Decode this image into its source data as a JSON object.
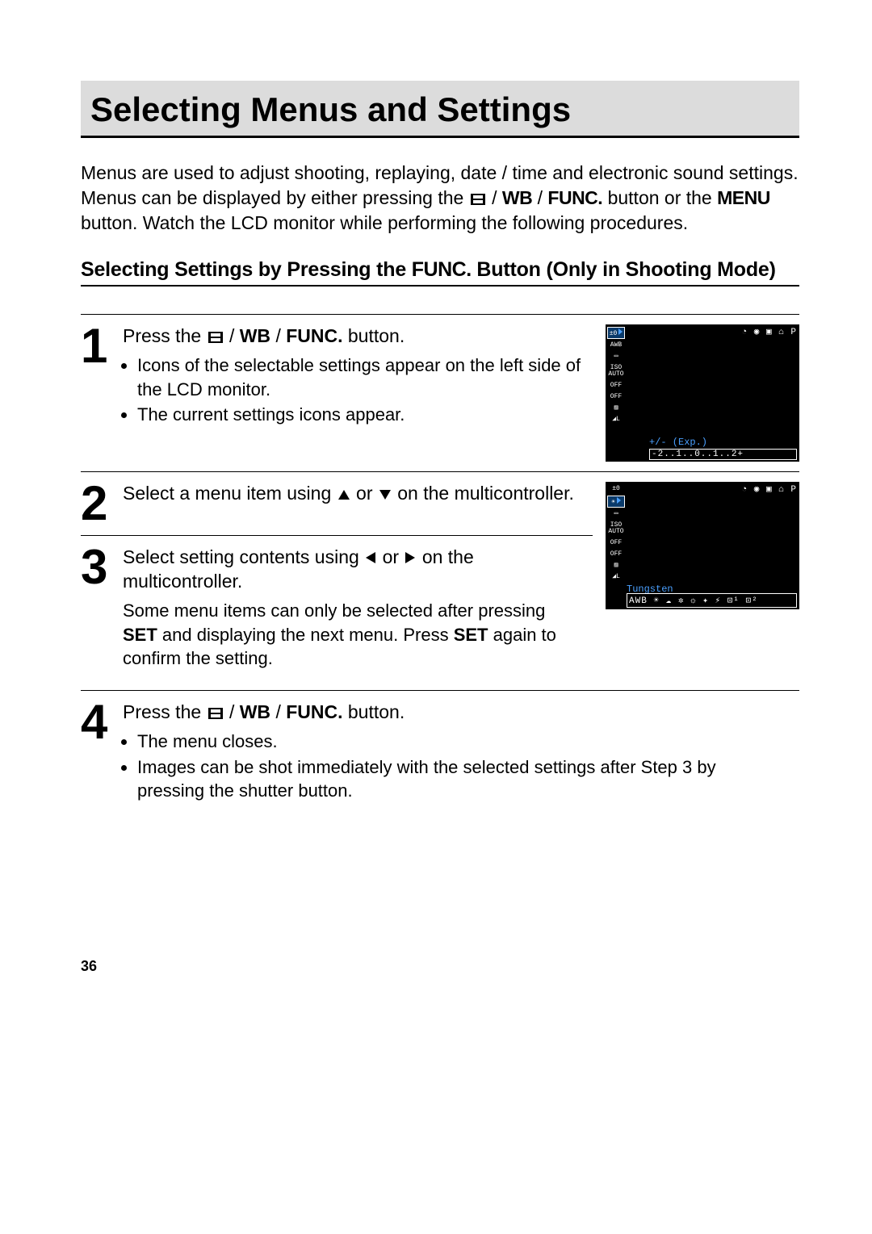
{
  "page": {
    "title": "Selecting Menus and Settings",
    "page_number": "36"
  },
  "intro": {
    "text_pre": "Menus are used to adjust shooting, replaying, date / time and electronic sound settings. Menus can be displayed by either pressing the ",
    "wb": "WB",
    "slash": " / ",
    "func": "FUNC.",
    "text_mid": " button or the ",
    "menu": "MENU",
    "text_post": " button. Watch the LCD monitor while performing the following procedures."
  },
  "subhead": {
    "pre": "Selecting Settings by Pressing the ",
    "func": "FUNC.",
    "post": " Button (Only in Shooting Mode)"
  },
  "steps": {
    "s1": {
      "num": "1",
      "head_pre": "Press the ",
      "wb": "WB",
      "slash": " / ",
      "func": "FUNC.",
      "head_post": " button.",
      "bullet1": "Icons of the selectable settings appear on the left side of the LCD monitor.",
      "bullet2": "The current settings icons appear."
    },
    "s2": {
      "num": "2",
      "head_pre": "Select a menu item using ",
      "head_mid": " or ",
      "head_post": " on the multicontroller."
    },
    "s3": {
      "num": "3",
      "head_pre": "Select setting contents using ",
      "head_mid": " or ",
      "head_post": " on the multicontroller.",
      "detail_pre": "Some menu items can only be selected after pressing ",
      "set1": "SET",
      "detail_mid": " and displaying the next menu. Press ",
      "set2": "SET",
      "detail_post": " again to confirm the setting."
    },
    "s4": {
      "num": "4",
      "head_pre": "Press the ",
      "wb": "WB",
      "slash": " / ",
      "func": "FUNC.",
      "head_post": " button.",
      "bullet1": "The menu closes.",
      "bullet2": "Images can be shot immediately with the selected settings after Step 3 by pressing the shutter button."
    }
  },
  "lcd1": {
    "top_icons": "◔ ◉   ▣ ⌂ P",
    "side": {
      "i0": "±0",
      "i1": "AWB",
      "i2": "▭",
      "i3": "ISO\nAUTO",
      "i4": "OFF",
      "i5": "OFF",
      "i6": "▨",
      "i7": "◢L"
    },
    "caption": "+/- (Exp.)",
    "scale": "-2..1..0..1..2+"
  },
  "lcd2": {
    "top_icons": "◔ ◉   ▣ ⌂ P",
    "side": {
      "i0": "±0",
      "i1": "☀",
      "i2": "▭",
      "i3": "ISO\nAUTO",
      "i4": "OFF",
      "i5": "OFF",
      "i6": "▨",
      "i7": "◢L"
    },
    "caption": "Tungsten",
    "options": "AWB ☀ ☁ ✲ ☼ ✦ ⚡ ⊡¹ ⊡²",
    "highlight": "✲"
  }
}
